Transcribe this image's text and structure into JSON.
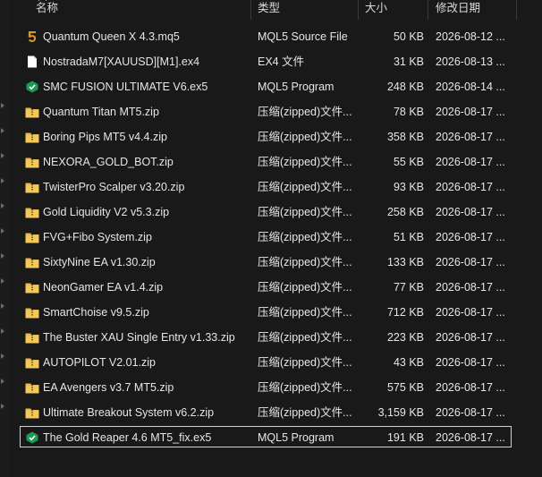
{
  "columns": {
    "name": "名称",
    "type": "类型",
    "size": "大小",
    "date": "修改日期"
  },
  "files": [
    {
      "name": "Quantum Queen X 4.3.mq5",
      "type": "MQL5 Source File",
      "size": "50 KB",
      "date": "2026-08-12 ...",
      "icon": "mql5-source-icon"
    },
    {
      "name": "NostradaM7[XAUUSD][M1].ex4",
      "type": "EX4 文件",
      "size": "31 KB",
      "date": "2026-08-13 ...",
      "icon": "blank-file-icon"
    },
    {
      "name": "SMC FUSION ULTIMATE V6.ex5",
      "type": "MQL5 Program",
      "size": "248 KB",
      "date": "2026-08-14 ...",
      "icon": "mql5-program-icon"
    },
    {
      "name": "Quantum Titan MT5.zip",
      "type": "压缩(zipped)文件...",
      "size": "78 KB",
      "date": "2026-08-17 ...",
      "icon": "zip-folder-icon"
    },
    {
      "name": "Boring Pips MT5 v4.4.zip",
      "type": "压缩(zipped)文件...",
      "size": "358 KB",
      "date": "2026-08-17 ...",
      "icon": "zip-folder-icon"
    },
    {
      "name": "NEXORA_GOLD_BOT.zip",
      "type": "压缩(zipped)文件...",
      "size": "55 KB",
      "date": "2026-08-17 ...",
      "icon": "zip-folder-icon"
    },
    {
      "name": "TwisterPro Scalper v3.20.zip",
      "type": "压缩(zipped)文件...",
      "size": "93 KB",
      "date": "2026-08-17 ...",
      "icon": "zip-folder-icon"
    },
    {
      "name": "Gold Liquidity V2 v5.3.zip",
      "type": "压缩(zipped)文件...",
      "size": "258 KB",
      "date": "2026-08-17 ...",
      "icon": "zip-folder-icon"
    },
    {
      "name": "FVG+Fibo System.zip",
      "type": "压缩(zipped)文件...",
      "size": "51 KB",
      "date": "2026-08-17 ...",
      "icon": "zip-folder-icon"
    },
    {
      "name": "SixtyNine EA v1.30.zip",
      "type": "压缩(zipped)文件...",
      "size": "133 KB",
      "date": "2026-08-17 ...",
      "icon": "zip-folder-icon"
    },
    {
      "name": "NeonGamer EA v1.4.zip",
      "type": "压缩(zipped)文件...",
      "size": "77 KB",
      "date": "2026-08-17 ...",
      "icon": "zip-folder-icon"
    },
    {
      "name": "SmartChoise v9.5.zip",
      "type": "压缩(zipped)文件...",
      "size": "712 KB",
      "date": "2026-08-17 ...",
      "icon": "zip-folder-icon"
    },
    {
      "name": "The Buster XAU Single Entry v1.33.zip",
      "type": "压缩(zipped)文件...",
      "size": "223 KB",
      "date": "2026-08-17 ...",
      "icon": "zip-folder-icon"
    },
    {
      "name": "AUTOPILOT V2.01.zip",
      "type": "压缩(zipped)文件...",
      "size": "43 KB",
      "date": "2026-08-17 ...",
      "icon": "zip-folder-icon"
    },
    {
      "name": "EA Avengers v3.7 MT5.zip",
      "type": "压缩(zipped)文件...",
      "size": "575 KB",
      "date": "2026-08-17 ...",
      "icon": "zip-folder-icon"
    },
    {
      "name": "Ultimate Breakout System v6.2.zip",
      "type": "压缩(zipped)文件...",
      "size": "3,159 KB",
      "date": "2026-08-17 ...",
      "icon": "zip-folder-icon"
    },
    {
      "name": "The Gold Reaper 4.6 MT5_fix.ex5",
      "type": "MQL5 Program",
      "size": "191 KB",
      "date": "2026-08-17 ...",
      "icon": "mql5-program-icon",
      "selected": true
    }
  ],
  "colors": {
    "background": "#191919",
    "text": "#e6e6e6",
    "folder": "#e8b84a",
    "mql5_green": "#1f9a55",
    "mql5_source": "#d99a2b"
  }
}
